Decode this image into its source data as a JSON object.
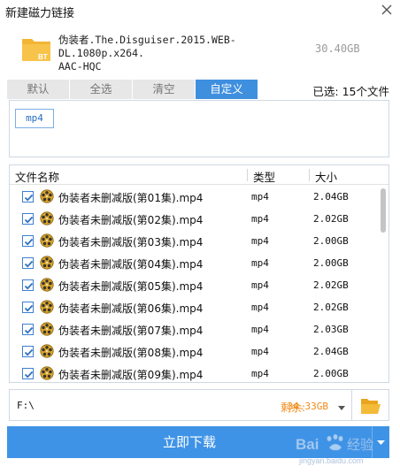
{
  "window": {
    "title": "新建磁力链接"
  },
  "torrent": {
    "badge": "BT",
    "name_line1": "伪装者.The.Disguiser.2015.WEB-DL.1080p.x264.",
    "name_line2": "AAC-HQC",
    "size": "30.40GB"
  },
  "tabs": [
    {
      "label": "默认",
      "active": false
    },
    {
      "label": "全选",
      "active": false
    },
    {
      "label": "清空",
      "active": false
    },
    {
      "label": "自定义",
      "active": true
    }
  ],
  "selected_count": "已选: 15个文件",
  "filter_chips": [
    "mp4"
  ],
  "table": {
    "columns": {
      "name": "文件名称",
      "type": "类型",
      "size": "大小"
    },
    "rows": [
      {
        "name": "伪装者未删减版(第01集).mp4",
        "type": "mp4",
        "size": "2.04GB",
        "checked": true
      },
      {
        "name": "伪装者未删减版(第02集).mp4",
        "type": "mp4",
        "size": "2.02GB",
        "checked": true
      },
      {
        "name": "伪装者未删减版(第03集).mp4",
        "type": "mp4",
        "size": "2.00GB",
        "checked": true
      },
      {
        "name": "伪装者未删减版(第04集).mp4",
        "type": "mp4",
        "size": "2.00GB",
        "checked": true
      },
      {
        "name": "伪装者未删减版(第05集).mp4",
        "type": "mp4",
        "size": "2.02GB",
        "checked": true
      },
      {
        "name": "伪装者未删减版(第06集).mp4",
        "type": "mp4",
        "size": "2.02GB",
        "checked": true
      },
      {
        "name": "伪装者未删减版(第07集).mp4",
        "type": "mp4",
        "size": "2.03GB",
        "checked": true
      },
      {
        "name": "伪装者未删减版(第08集).mp4",
        "type": "mp4",
        "size": "2.04GB",
        "checked": true
      },
      {
        "name": "伪装者未删减版(第09集).mp4",
        "type": "mp4",
        "size": "2.00GB",
        "checked": true
      }
    ]
  },
  "save_path": {
    "value": "F:\\",
    "free_label": "剩余:",
    "free_value": "34.33GB"
  },
  "download_button": "立即下载",
  "watermark": {
    "brand_bai": "Bai",
    "brand_jingyan": "经验",
    "url": "jingyan.baidu.com"
  },
  "colors": {
    "accent": "#3f93e6",
    "tab_active": "#3f8fdf",
    "free_space": "#ef8a1a"
  },
  "icons": {
    "close": "close-icon",
    "folder": "bt-folder-icon",
    "file": "film-reel-icon",
    "browse": "open-folder-icon"
  }
}
